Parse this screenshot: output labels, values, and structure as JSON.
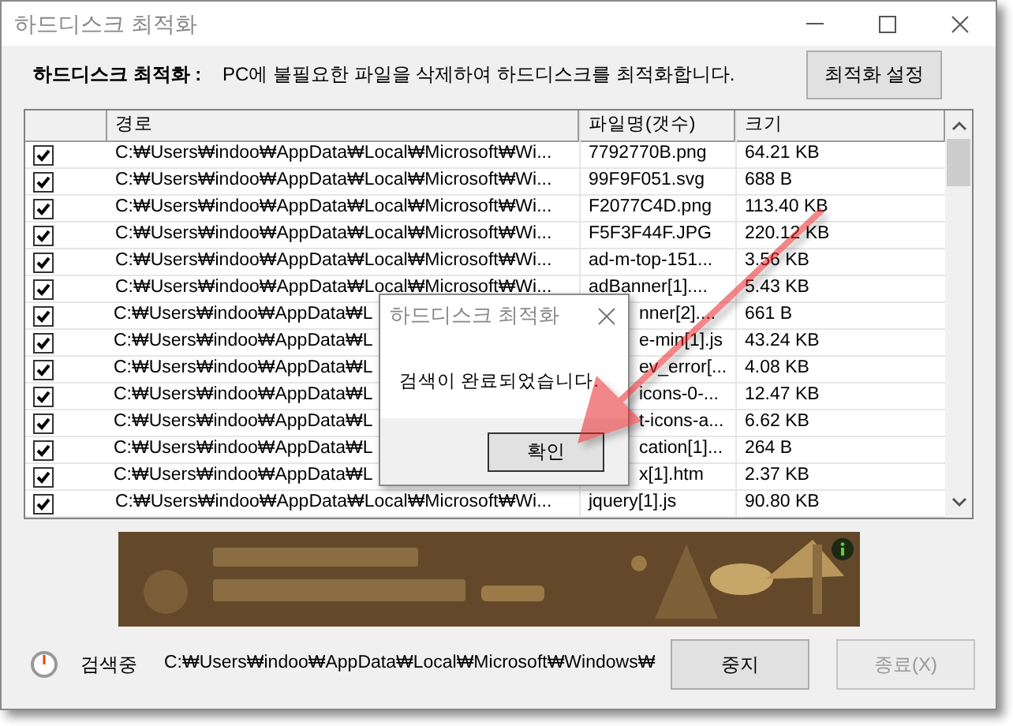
{
  "window": {
    "title": "하드디스크 최적화"
  },
  "header": {
    "label": "하드디스크 최적화 :",
    "description": "PC에 불필요한 파일을 삭제하여 하드디스크를 최적화합니다.",
    "settings_button": "최적화 설정"
  },
  "file_list": {
    "columns": [
      "경로",
      "파일명(갯수)",
      "크기"
    ],
    "rows": [
      {
        "checked": true,
        "path": "C:₩Users₩indoo₩AppData₩Local₩Microsoft₩Wi...",
        "filename": "7792770B.png",
        "size": "64.21 KB"
      },
      {
        "checked": true,
        "path": "C:₩Users₩indoo₩AppData₩Local₩Microsoft₩Wi...",
        "filename": "99F9F051.svg",
        "size": "688 B"
      },
      {
        "checked": true,
        "path": "C:₩Users₩indoo₩AppData₩Local₩Microsoft₩Wi...",
        "filename": "F2077C4D.png",
        "size": "113.40 KB"
      },
      {
        "checked": true,
        "path": "C:₩Users₩indoo₩AppData₩Local₩Microsoft₩Wi...",
        "filename": "F5F3F44F.JPG",
        "size": "220.12 KB"
      },
      {
        "checked": true,
        "path": "C:₩Users₩indoo₩AppData₩Local₩Microsoft₩Wi...",
        "filename": "ad-m-top-151...",
        "size": "3.56 KB"
      },
      {
        "checked": true,
        "path": "C:₩Users₩indoo₩AppData₩Local₩Microsoft₩Wi...",
        "filename": "adBanner[1]....",
        "size": "5.43 KB"
      },
      {
        "checked": true,
        "path": "C:₩Users₩indoo₩AppData₩L",
        "filename": "nner[2]....",
        "size": "661 B"
      },
      {
        "checked": true,
        "path": "C:₩Users₩indoo₩AppData₩L",
        "filename": "e-min[1].js",
        "size": "43.24 KB"
      },
      {
        "checked": true,
        "path": "C:₩Users₩indoo₩AppData₩L",
        "filename": "ev_error[...",
        "size": "4.08 KB"
      },
      {
        "checked": true,
        "path": "C:₩Users₩indoo₩AppData₩L",
        "filename": "icons-0-...",
        "size": "12.47 KB"
      },
      {
        "checked": true,
        "path": "C:₩Users₩indoo₩AppData₩L",
        "filename": "t-icons-a...",
        "size": "6.62 KB"
      },
      {
        "checked": true,
        "path": "C:₩Users₩indoo₩AppData₩L",
        "filename": "cation[1]...",
        "size": "264 B"
      },
      {
        "checked": true,
        "path": "C:₩Users₩indoo₩AppData₩L",
        "filename": "x[1].htm",
        "size": "2.37 KB"
      },
      {
        "checked": true,
        "path": "C:₩Users₩indoo₩AppData₩Local₩Microsoft₩Wi...",
        "filename": "jquery[1].js",
        "size": "90.80 KB"
      }
    ]
  },
  "status": {
    "label": "검색중",
    "current_path": "C:₩Users₩indoo₩AppData₩Local₩Microsoft₩Windows₩"
  },
  "buttons": [
    {
      "label": "중지",
      "disabled": false
    },
    {
      "label": "종료(X)",
      "disabled": true
    }
  ],
  "dialog": {
    "title": "하드디스크 최적화",
    "message": "검색이 완료되었습니다.",
    "button": "확인"
  }
}
